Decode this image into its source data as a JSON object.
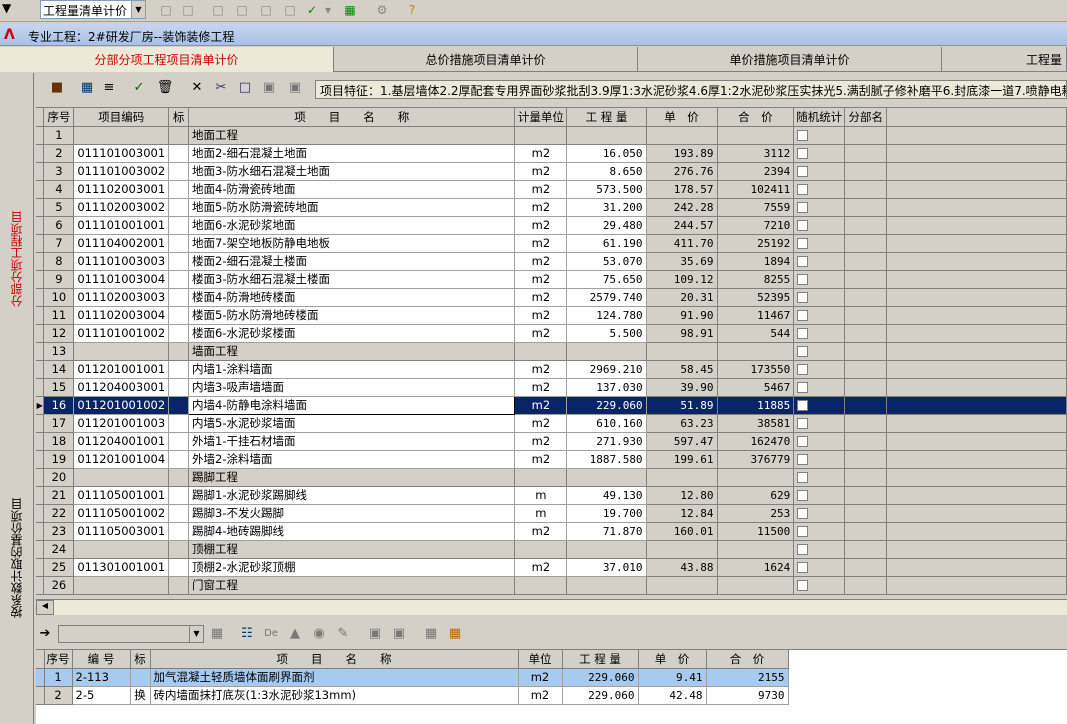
{
  "toolbar": {
    "view_select_value": "工程量清单计价"
  },
  "project": {
    "label": "专业工程：2#研发厂房--装饰装修工程"
  },
  "tabs": [
    {
      "label": "分部分项工程项目清单计价",
      "active": true
    },
    {
      "label": "总价措施项目清单计价",
      "active": false
    },
    {
      "label": "单价措施项目清单计价",
      "active": false
    },
    {
      "label": "工程量",
      "active": false
    }
  ],
  "side_tabs": [
    {
      "label": "分部分项工程项目",
      "active": true
    },
    {
      "label": "按系数计取的基价项目",
      "active": false
    }
  ],
  "feature_text": "项目特征：1.基层墙体2.2厚配套专用界面砂浆批刮3.9厚1:3水泥砂浆4.6厚1:2水泥砂浆压实抹光5.满刮腻子修补磨平6.封底漆一道7.喷静电耗",
  "main_table": {
    "headers": [
      "序号",
      "项目编码",
      "标",
      "项　　目　　名　　称",
      "计量单位",
      "工 程 量",
      "单　价",
      "合　价",
      "随机统计",
      "分部名"
    ],
    "rows": [
      {
        "no": "1",
        "code": "",
        "mark": "",
        "name": "地面工程",
        "unit": "",
        "qty": "",
        "price": "",
        "total": "",
        "group": true
      },
      {
        "no": "2",
        "code": "011101003001",
        "mark": "",
        "name": "地面2-细石混凝土地面",
        "unit": "m2",
        "qty": "16.050",
        "price": "193.89",
        "total": "3112"
      },
      {
        "no": "3",
        "code": "011101003002",
        "mark": "",
        "name": "地面3-防水细石混凝土地面",
        "unit": "m2",
        "qty": "8.650",
        "price": "276.76",
        "total": "2394"
      },
      {
        "no": "4",
        "code": "011102003001",
        "mark": "",
        "name": "地面4-防滑瓷砖地面",
        "unit": "m2",
        "qty": "573.500",
        "price": "178.57",
        "total": "102411"
      },
      {
        "no": "5",
        "code": "011102003002",
        "mark": "",
        "name": "地面5-防水防滑瓷砖地面",
        "unit": "m2",
        "qty": "31.200",
        "price": "242.28",
        "total": "7559"
      },
      {
        "no": "6",
        "code": "011101001001",
        "mark": "",
        "name": "地面6-水泥砂浆地面",
        "unit": "m2",
        "qty": "29.480",
        "price": "244.57",
        "total": "7210"
      },
      {
        "no": "7",
        "code": "011104002001",
        "mark": "",
        "name": "地面7-架空地板防静电地板",
        "unit": "m2",
        "qty": "61.190",
        "price": "411.70",
        "total": "25192"
      },
      {
        "no": "8",
        "code": "011101003003",
        "mark": "",
        "name": "楼面2-细石混凝土楼面",
        "unit": "m2",
        "qty": "53.070",
        "price": "35.69",
        "total": "1894"
      },
      {
        "no": "9",
        "code": "011101003004",
        "mark": "",
        "name": "楼面3-防水细石混凝土楼面",
        "unit": "m2",
        "qty": "75.650",
        "price": "109.12",
        "total": "8255"
      },
      {
        "no": "10",
        "code": "011102003003",
        "mark": "",
        "name": "楼面4-防滑地砖楼面",
        "unit": "m2",
        "qty": "2579.740",
        "price": "20.31",
        "total": "52395"
      },
      {
        "no": "11",
        "code": "011102003004",
        "mark": "",
        "name": "楼面5-防水防滑地砖楼面",
        "unit": "m2",
        "qty": "124.780",
        "price": "91.90",
        "total": "11467"
      },
      {
        "no": "12",
        "code": "011101001002",
        "mark": "",
        "name": "楼面6-水泥砂浆楼面",
        "unit": "m2",
        "qty": "5.500",
        "price": "98.91",
        "total": "544"
      },
      {
        "no": "13",
        "code": "",
        "mark": "",
        "name": "墙面工程",
        "unit": "",
        "qty": "",
        "price": "",
        "total": "",
        "group": true
      },
      {
        "no": "14",
        "code": "011201001001",
        "mark": "",
        "name": "内墙1-涂料墙面",
        "unit": "m2",
        "qty": "2969.210",
        "price": "58.45",
        "total": "173550"
      },
      {
        "no": "15",
        "code": "011204003001",
        "mark": "",
        "name": "内墙3-吸声墙墙面",
        "unit": "m2",
        "qty": "137.030",
        "price": "39.90",
        "total": "5467"
      },
      {
        "no": "16",
        "code": "011201001002",
        "mark": "",
        "name": "内墙4-防静电涂料墙面",
        "unit": "m2",
        "qty": "229.060",
        "price": "51.89",
        "total": "11885",
        "selected": true
      },
      {
        "no": "17",
        "code": "011201001003",
        "mark": "",
        "name": "内墙5-水泥砂浆墙面",
        "unit": "m2",
        "qty": "610.160",
        "price": "63.23",
        "total": "38581"
      },
      {
        "no": "18",
        "code": "011204001001",
        "mark": "",
        "name": "外墙1-干挂石材墙面",
        "unit": "m2",
        "qty": "271.930",
        "price": "597.47",
        "total": "162470"
      },
      {
        "no": "19",
        "code": "011201001004",
        "mark": "",
        "name": "外墙2-涂料墙面",
        "unit": "m2",
        "qty": "1887.580",
        "price": "199.61",
        "total": "376779"
      },
      {
        "no": "20",
        "code": "",
        "mark": "",
        "name": "踢脚工程",
        "unit": "",
        "qty": "",
        "price": "",
        "total": "",
        "group": true
      },
      {
        "no": "21",
        "code": "011105001001",
        "mark": "",
        "name": "踢脚1-水泥砂浆踢脚线",
        "unit": "m",
        "qty": "49.130",
        "price": "12.80",
        "total": "629"
      },
      {
        "no": "22",
        "code": "011105001002",
        "mark": "",
        "name": "踢脚3-不发火踢脚",
        "unit": "m",
        "qty": "19.700",
        "price": "12.84",
        "total": "253"
      },
      {
        "no": "23",
        "code": "011105003001",
        "mark": "",
        "name": "踢脚4-地砖踢脚线",
        "unit": "m2",
        "qty": "71.870",
        "price": "160.01",
        "total": "11500"
      },
      {
        "no": "24",
        "code": "",
        "mark": "",
        "name": "顶棚工程",
        "unit": "",
        "qty": "",
        "price": "",
        "total": "",
        "group": true
      },
      {
        "no": "25",
        "code": "011301001001",
        "mark": "",
        "name": "顶棚2-水泥砂浆顶棚",
        "unit": "m2",
        "qty": "37.010",
        "price": "43.88",
        "total": "1624"
      },
      {
        "no": "26",
        "code": "",
        "mark": "",
        "name": "门窗工程",
        "unit": "",
        "qty": "",
        "price": "",
        "total": "",
        "group": true
      }
    ]
  },
  "sub_table": {
    "headers": [
      "序号",
      "编 号",
      "标",
      "项　　目　　名　　称",
      "单位",
      "工 程 量",
      "单　价",
      "合　价"
    ],
    "rows": [
      {
        "no": "1",
        "code": "2-113",
        "mark": "",
        "name": "加气混凝土轻质墙体面刷界面剂",
        "unit": "m2",
        "qty": "229.060",
        "price": "9.41",
        "total": "2155",
        "highlight": true
      },
      {
        "no": "2",
        "code": "2-5",
        "mark": "换",
        "name": "砖内墙面抹打底灰(1:3水泥砂浆13mm)",
        "unit": "m2",
        "qty": "229.060",
        "price": "42.48",
        "total": "9730"
      }
    ]
  }
}
